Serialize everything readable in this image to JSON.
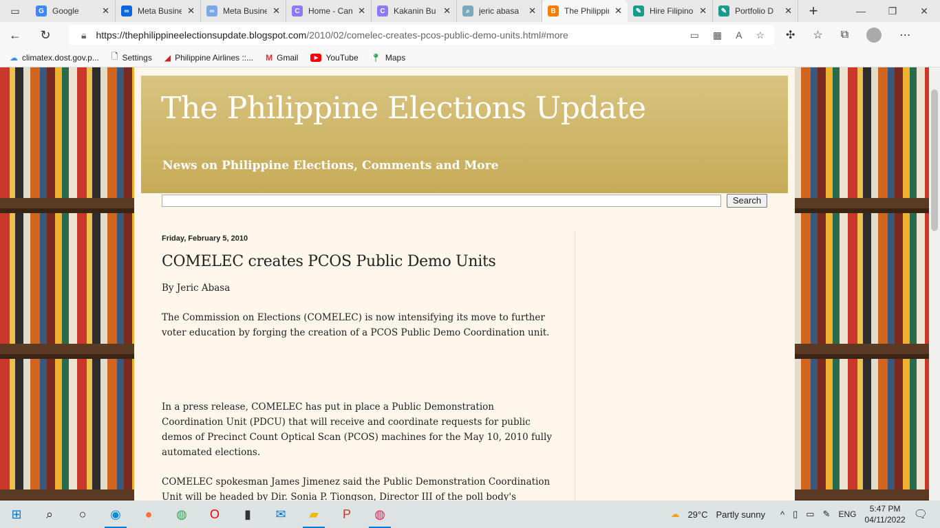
{
  "tabs": [
    {
      "label": "Google",
      "color": "#4285f4",
      "g": "G"
    },
    {
      "label": "Meta Business",
      "color": "#0668e1",
      "g": "∞"
    },
    {
      "label": "Meta Business",
      "color": "#7aa7e8",
      "g": "∞"
    },
    {
      "label": "Home - Canva",
      "color": "#8b7cf6",
      "g": "C"
    },
    {
      "label": "Kakanin Bu",
      "color": "#8b7cf6",
      "g": "C"
    },
    {
      "label": "jeric abasa",
      "color": "#7ab",
      "g": "⌕"
    },
    {
      "label": "The Philippine",
      "color": "#f57d00",
      "g": "B",
      "active": true
    },
    {
      "label": "Hire Filipino",
      "color": "#1a9a8a",
      "g": "✎"
    },
    {
      "label": "Portfolio D",
      "color": "#1a9a8a",
      "g": "✎"
    }
  ],
  "address": {
    "host": "https://thephilippineelectionsupdate.blogspot.com",
    "path": "/2010/02/comelec-creates-pcos-public-demo-units.html#more"
  },
  "bookmarks": [
    "climatex.dost.gov.p...",
    "Settings",
    "Philippine Airlines ::...",
    "Gmail",
    "YouTube",
    "Maps"
  ],
  "blog": {
    "title": "The Philippine Elections Update",
    "description": "News on Philippine Elections, Comments and More",
    "search_label": "Search"
  },
  "post": {
    "date": "Friday, February 5, 2010",
    "title": "COMELEC creates PCOS Public Demo Units",
    "paragraphs": [
      "By Jeric Abasa",
      "The Commission on Elections (COMELEC) is now intensifying its move to further voter education by forging the creation of a PCOS Public Demo Coordination unit.",
      "In a press release, COMELEC has put in place a Public Demonstration Coordination Unit (PDCU) that will receive and coordinate requests for public demos of Precinct Count Optical Scan (PCOS) machines for the May 10, 2010 fully automated elections.",
      "COMELEC spokesman James Jimenez said the Public Demonstration Coordination Unit will be headed by Dir. Sonia P. Tiongson, Director III of the poll body's"
    ]
  },
  "taskbar": {
    "weather": "29°C",
    "weather_text": "Partly sunny",
    "lang": "ENG",
    "time": "5:47 PM",
    "date": "04/11/2022"
  }
}
